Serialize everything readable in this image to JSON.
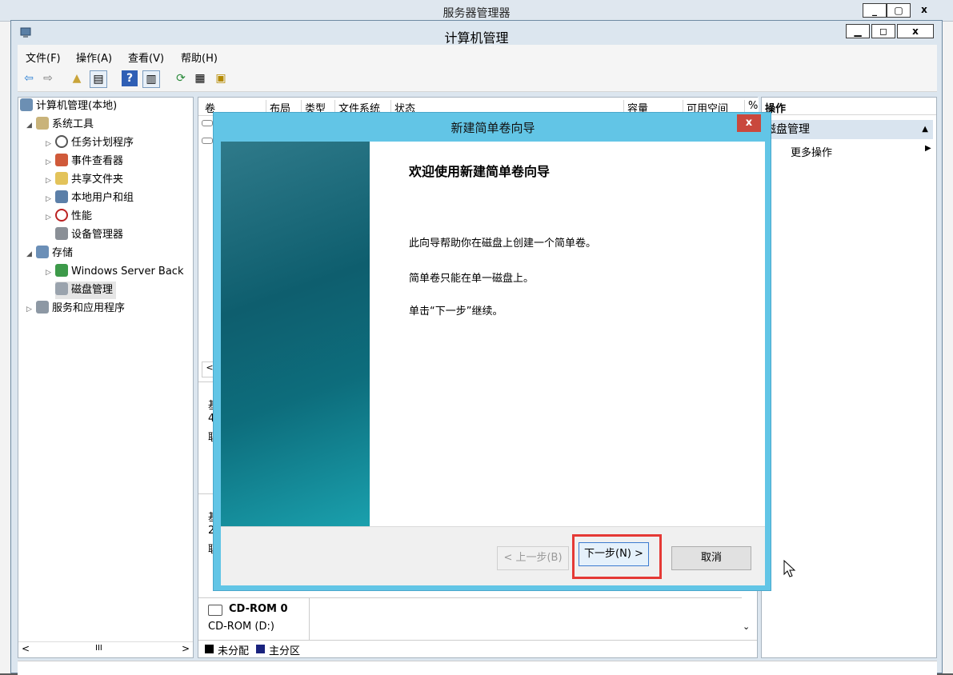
{
  "bg_window": {
    "title": "服务器管理器"
  },
  "main_window": {
    "title": "计算机管理",
    "controls": {
      "minimize": "▁",
      "maximize": "◻",
      "close": "x"
    }
  },
  "menu": [
    "文件(F)",
    "操作(A)",
    "查看(V)",
    "帮助(H)"
  ],
  "toolbar": {
    "back": "back-arrow-icon",
    "forward": "forward-arrow-icon",
    "up": "folder-up-icon",
    "show_hide": "console-tree-icon",
    "help": "help-icon",
    "view": "view-icon",
    "refresh": "refresh-icon",
    "properties": "properties-icon",
    "export": "export-icon"
  },
  "tree": {
    "root": "计算机管理(本地)",
    "system_tools": "系统工具",
    "task_scheduler": "任务计划程序",
    "event_viewer": "事件查看器",
    "shared_folders": "共享文件夹",
    "local_users": "本地用户和组",
    "performance": "性能",
    "device_manager": "设备管理器",
    "storage": "存储",
    "windows_backup": "Windows Server Back",
    "disk_management": "磁盘管理",
    "services_apps": "服务和应用程序"
  },
  "list": {
    "columns": [
      "卷",
      "布局",
      "类型",
      "文件系统",
      "状态",
      "容量",
      "可用空间",
      "%"
    ],
    "disk_rows": [
      {
        "line1": "基",
        "line2": "4",
        "line3": "联"
      },
      {
        "line1": "基",
        "line2": "2",
        "line3": "联"
      }
    ],
    "cdrom": {
      "name": "CD-ROM 0",
      "drive": "CD-ROM (D:)"
    },
    "legend": {
      "unallocated": "未分配",
      "primary": "主分区"
    }
  },
  "actions": {
    "header": "操作",
    "section": "磁盘管理",
    "more": "更多操作"
  },
  "dialog": {
    "title": "新建简单卷向导",
    "close": "x",
    "heading": "欢迎使用新建简单卷向导",
    "line1": "此向导帮助你在磁盘上创建一个简单卷。",
    "line2": "简单卷只能在单一磁盘上。",
    "line3": "单击“下一步”继续。",
    "back_button": "< 上一步(B)",
    "next_button": "下一步(N) >",
    "cancel_button": "取消"
  },
  "scrollbar": {
    "hscroll_mid": "III",
    "left": "<",
    "right": ">"
  },
  "colors": {
    "dialog_frame": "#62c5e6",
    "highlight": "#e53935",
    "close_button": "#c9483d",
    "primary_partition": "#1a237e",
    "unallocated": "#000000"
  }
}
